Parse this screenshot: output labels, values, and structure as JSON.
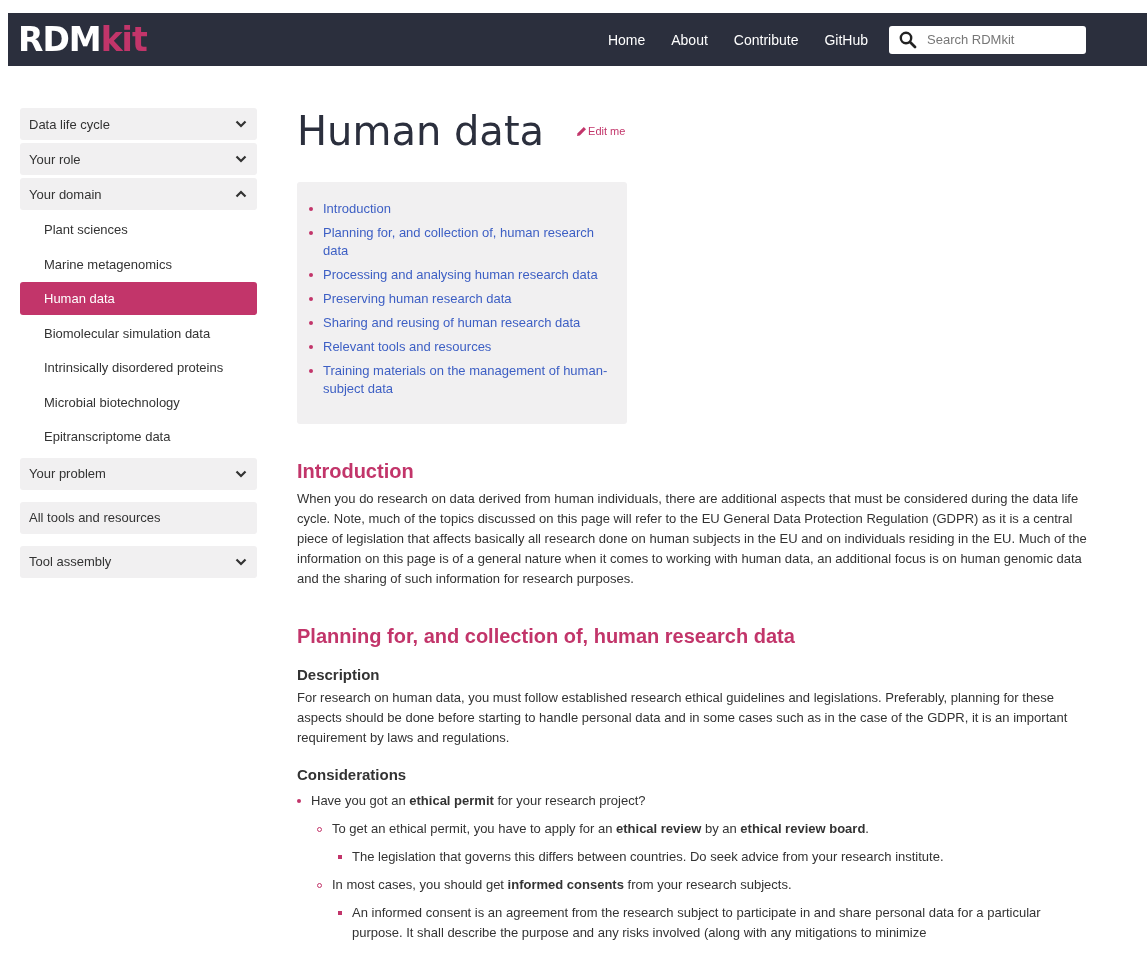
{
  "navbar": {
    "logo": {
      "text_1": "RDM",
      "text_2": "kit"
    },
    "links": [
      "Home",
      "About",
      "Contribute",
      "GitHub"
    ],
    "search": {
      "placeholder": "Search RDMkit"
    }
  },
  "sidebar": {
    "items": [
      {
        "kind": "section",
        "label": "Data life cycle",
        "expanded": false
      },
      {
        "kind": "section",
        "label": "Your role",
        "expanded": false
      },
      {
        "kind": "section",
        "label": "Your domain",
        "expanded": true,
        "children": [
          {
            "label": "Plant sciences",
            "selected": false
          },
          {
            "label": "Marine metagenomics",
            "selected": false
          },
          {
            "label": "Human data",
            "selected": true
          },
          {
            "label": "Biomolecular simulation data",
            "selected": false
          },
          {
            "label": "Intrinsically disordered proteins",
            "selected": false
          },
          {
            "label": "Microbial biotechnology",
            "selected": false
          },
          {
            "label": "Epitranscriptome data",
            "selected": false
          }
        ]
      },
      {
        "kind": "section",
        "label": "Your problem",
        "expanded": false
      },
      {
        "kind": "link",
        "label": "All tools and resources"
      },
      {
        "kind": "section",
        "label": "Tool assembly",
        "expanded": false
      }
    ]
  },
  "page": {
    "title": "Human data",
    "edit_link": "Edit me",
    "toc": [
      "Introduction",
      "Planning for, and collection of, human research data",
      "Processing and analysing human research data",
      "Preserving human research data",
      "Sharing and reusing of human research data",
      "Relevant tools and resources",
      "Training materials on the management of human-subject data"
    ],
    "sections": [
      {
        "heading": "Introduction",
        "blocks": [
          {
            "kind": "paragraph",
            "text": "When you do research on data derived from human individuals, there are additional aspects that must be considered during the data life cycle. Note, much of the topics discussed on this page will refer to the EU General Data Protection Regulation (GDPR) as it is a central piece of legislation that affects basically all research done on human subjects in the EU and on individuals residing in the EU. Much of the information on this page is of a general nature when it comes to working with human data, an additional focus is on human genomic data and the sharing of such information for research purposes."
          }
        ]
      },
      {
        "heading": "Planning for, and collection of, human research data",
        "blocks": [
          {
            "kind": "subheading",
            "text": "Description"
          },
          {
            "kind": "paragraph",
            "text": "For research on human data, you must follow established research ethical guidelines and legislations. Preferably, planning for these aspects should be done before starting to handle personal data and in some cases such as in the case of the GDPR, it is an important requirement by laws and regulations."
          },
          {
            "kind": "subheading",
            "text": "Considerations"
          },
          {
            "kind": "list",
            "items": [
              {
                "text": "Have you got an **ethical permit** for your research project?",
                "children": [
                  {
                    "text": "To get an ethical permit, you have to apply for an **ethical review** by an **ethical review board**.",
                    "children": [
                      {
                        "text": "The legislation that governs this differs between countries. Do seek advice from your research institute."
                      }
                    ]
                  },
                  {
                    "text": "In most cases, you should get **informed consents** from your research subjects.",
                    "children": [
                      {
                        "text": "An informed consent is an agreement from the research subject to participate in and share personal data for a particular purpose. It shall describe the purpose and any risks involved (along with any mitigations to minimize"
                      }
                    ]
                  }
                ]
              }
            ]
          }
        ]
      }
    ]
  }
}
